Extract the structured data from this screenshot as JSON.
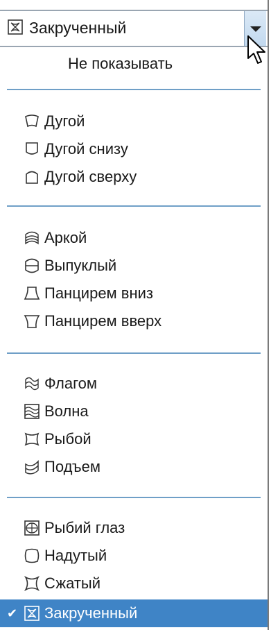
{
  "combo": {
    "value": "Закрученный",
    "icon": "twist-icon"
  },
  "menu": {
    "none_label": "Не показывать",
    "groups": [
      {
        "items": [
          {
            "label": "Дугой",
            "icon": "arc-icon"
          },
          {
            "label": "Дугой снизу",
            "icon": "arc-lower-icon"
          },
          {
            "label": "Дугой сверху",
            "icon": "arc-upper-icon"
          }
        ]
      },
      {
        "items": [
          {
            "label": "Аркой",
            "icon": "arch-icon"
          },
          {
            "label": "Выпуклый",
            "icon": "bulge-icon"
          },
          {
            "label": "Панцирем вниз",
            "icon": "shell-lower-icon"
          },
          {
            "label": "Панцирем вверх",
            "icon": "shell-upper-icon"
          }
        ]
      },
      {
        "items": [
          {
            "label": "Флагом",
            "icon": "flag-icon"
          },
          {
            "label": "Волна",
            "icon": "wave-icon"
          },
          {
            "label": "Рыбой",
            "icon": "fish-icon"
          },
          {
            "label": "Подъем",
            "icon": "rise-icon"
          }
        ]
      },
      {
        "items": [
          {
            "label": "Рыбий глаз",
            "icon": "fisheye-icon"
          },
          {
            "label": "Надутый",
            "icon": "inflate-icon"
          },
          {
            "label": "Сжатый",
            "icon": "squeeze-icon"
          },
          {
            "label": "Закрученный",
            "icon": "twist-icon",
            "selected": true
          }
        ]
      }
    ]
  },
  "colors": {
    "selection": "#3f84c6",
    "separator": "#6f9fc7"
  }
}
